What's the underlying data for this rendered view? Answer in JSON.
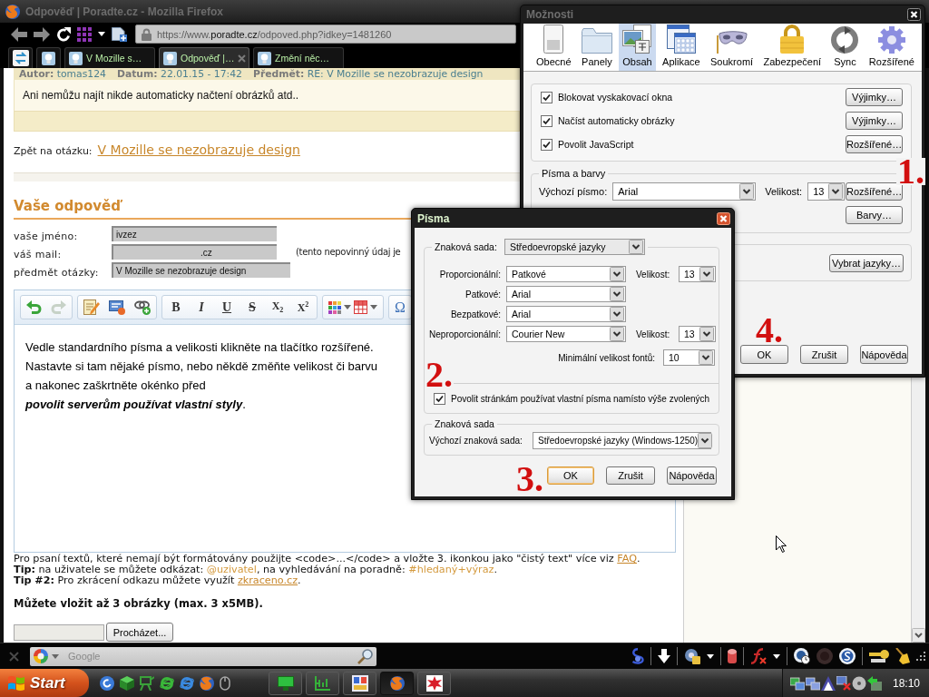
{
  "browser": {
    "title": "Odpověď | Poradte.cz - Mozilla Firefox",
    "active": false,
    "url": {
      "before_host": "https://www.",
      "host": "poradte.cz",
      "after_host": "/odpoved.php?idkey=1481260"
    },
    "tabs": [
      {
        "kind": "app",
        "selected": false
      },
      {
        "kind": "app",
        "selected": false
      },
      {
        "kind": "page",
        "label": "V Mozille s…",
        "selected": false
      },
      {
        "kind": "page",
        "label": "Odpověď |…",
        "selected": true
      },
      {
        "kind": "page",
        "label": "Změní něc…",
        "selected": false
      }
    ]
  },
  "page": {
    "post": {
      "meta": [
        {
          "label": "Autor:",
          "value": "tomas124"
        },
        {
          "label": "Datum:",
          "value": "22.01.15 - 17:42"
        },
        {
          "label": "Předmět:",
          "value": "RE: V Mozille se nezobrazuje design"
        }
      ],
      "text": "Ani nemůžu najít nikde automaticky načtení obrázků atd.."
    },
    "back": {
      "label": "Zpět na otázku:",
      "link": "V Mozille se nezobrazuje design"
    },
    "reply_heading": "Vaše odpověď",
    "form": [
      {
        "label": "vaše jméno:",
        "value": "ivzez"
      },
      {
        "label": "váš mail:",
        "value": ".cz",
        "note": "(tento nepovinný údaj je"
      },
      {
        "label": "předmět otázky:",
        "value": "V Mozille se nezobrazuje design"
      }
    ],
    "editor": {
      "toolbar": [
        {
          "buttons": [
            {
              "kind": "undo",
              "disabled": false
            },
            {
              "kind": "redo",
              "disabled": true
            }
          ]
        },
        {
          "buttons": [
            {
              "kind": "template"
            },
            {
              "kind": "html"
            },
            {
              "kind": "link"
            }
          ]
        },
        {
          "buttons": [
            {
              "kind": "bold",
              "label": "B"
            },
            {
              "kind": "italic",
              "label": "I"
            },
            {
              "kind": "underline",
              "label": "U"
            },
            {
              "kind": "strike",
              "label": "S"
            },
            {
              "kind": "subscript",
              "label": "X$_{2}$"
            },
            {
              "kind": "superscript",
              "label": "X$^{2}$"
            }
          ]
        },
        {
          "buttons": [
            {
              "kind": "colors"
            },
            {
              "kind": "table"
            }
          ]
        },
        {
          "buttons": [
            {
              "kind": "symbol",
              "label": "Ω"
            }
          ]
        }
      ],
      "lines": [
        {
          "parts": [
            {
              "kind": "text",
              "text": "Vedle standardního písma a velikosti klikněte na tlačítko rozšířené."
            }
          ]
        },
        {
          "parts": [
            {
              "kind": "text",
              "text": "Nastavte si tam nějaké písmo, nebo někdě změňte velikost či barvu"
            }
          ]
        },
        {
          "parts": [
            {
              "kind": "text",
              "text": "a nakonec zaškrtněte okénko před"
            }
          ]
        },
        {
          "parts": [
            {
              "kind": "emphasis",
              "text": "povolit serverům používat vlastní styly"
            },
            {
              "kind": "text",
              "text": "."
            }
          ]
        }
      ]
    },
    "help": [
      {
        "parts": [
          {
            "kind": "text",
            "text": "Pro psaní textů, které nemají být formátovány použijte <code>...</code> a vložte 3. ikonkou jako \"čistý text\" více viz "
          },
          {
            "kind": "link",
            "text": "FAQ"
          },
          {
            "kind": "text",
            "text": "."
          }
        ]
      },
      {
        "parts": [
          {
            "kind": "bold",
            "text": "Tip:"
          },
          {
            "kind": "text",
            "text": " na uživatele se můžete odkázat: "
          },
          {
            "kind": "highlight",
            "text": "@uzivatel"
          },
          {
            "kind": "text",
            "text": ", na vyhledávání na poradně: "
          },
          {
            "kind": "highlight",
            "text": "#hledaný+výraz"
          },
          {
            "kind": "text",
            "text": "."
          }
        ]
      },
      {
        "parts": [
          {
            "kind": "bold",
            "text": "Tip #2:"
          },
          {
            "kind": "text",
            "text": " Pro zkrácení odkazu můžete využít "
          },
          {
            "kind": "link",
            "text": "zkraceno.cz"
          },
          {
            "kind": "text",
            "text": "."
          }
        ]
      }
    ],
    "upload": {
      "heading": "Můžete vložit až 3 obrázky (max. 3 x5MB).",
      "button": "Procházet..."
    }
  },
  "search_bar": {
    "placeholder": "Google"
  },
  "options_dialog": {
    "title": "Možnosti",
    "active": false,
    "panes": [
      {
        "label": "Obecné",
        "selected": false
      },
      {
        "label": "Panely",
        "selected": false
      },
      {
        "label": "Obsah",
        "selected": true
      },
      {
        "label": "Aplikace",
        "selected": false
      },
      {
        "label": "Soukromí",
        "selected": false
      },
      {
        "label": "Zabezpečení",
        "selected": false
      },
      {
        "label": "Sync",
        "selected": false
      },
      {
        "label": "Rozšířené",
        "selected": false
      }
    ],
    "content": [
      {
        "label": "Blokovat vyskakovací okna",
        "checked": true,
        "button": "Výjimky…"
      },
      {
        "label": "Načíst automaticky obrázky",
        "checked": true,
        "button": "Výjimky…"
      },
      {
        "label": "Povolit JavaScript",
        "checked": true,
        "button": "Rozšířené…"
      }
    ],
    "fonts": {
      "legend": "Písma a barvy",
      "font_label": "Výchozí písmo:",
      "font": "Arial",
      "size_label": "Velikost:",
      "size": "13",
      "advanced_button": "Rozšířené…",
      "colors_button": "Barvy…"
    },
    "languages_button": "Vybrat jazyky…",
    "buttons": [
      "OK",
      "Zrušit",
      "Nápověda"
    ],
    "annotations": [
      "1.",
      "4."
    ]
  },
  "fonts_dialog": {
    "title": "Písma",
    "active": true,
    "charset_label": "Znaková sada:",
    "charset": "Středoevropské jazyky",
    "rows": [
      {
        "label": "Proporcionální:",
        "font": "Patkové",
        "size_label": "Velikost:",
        "size": "13"
      },
      {
        "label": "Patkové:",
        "font": "Arial"
      },
      {
        "label": "Bezpatkové:",
        "font": "Arial"
      },
      {
        "label": "Neproporcionální:",
        "font": "Courier New",
        "size_label": "Velikost:",
        "size": "13"
      }
    ],
    "min_size_label": "Minimální velikost fontů:",
    "min_size": "10",
    "allow_page_fonts": {
      "label": "Povolit stránkám používat vlastní písma namísto výše zvolených",
      "checked": true
    },
    "encoding": {
      "legend": "Znaková sada",
      "label": "Výchozí znaková sada:",
      "value": "Středoevropské jazyky (Windows-1250)"
    },
    "buttons": [
      {
        "label": "OK",
        "focused": true
      },
      {
        "label": "Zrušit",
        "focused": false
      },
      {
        "label": "Nápověda",
        "focused": false
      }
    ],
    "annotations": [
      "2.",
      "3."
    ]
  },
  "taskbar": {
    "start": "Start",
    "tasks": [
      {
        "selected": false
      },
      {
        "selected": false
      },
      {
        "selected": false
      },
      {
        "selected": true
      },
      {
        "selected": false
      }
    ],
    "clock": "18:10"
  }
}
